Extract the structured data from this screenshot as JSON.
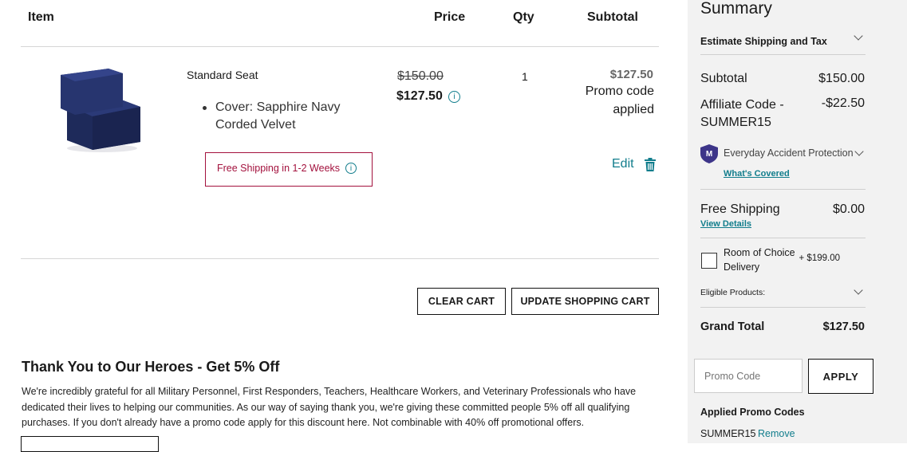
{
  "cart": {
    "headers": {
      "item": "Item",
      "price": "Price",
      "qty": "Qty",
      "subtotal": "Subtotal"
    },
    "item": {
      "name": "Standard Seat",
      "option": "Cover: Sapphire Navy Corded Velvet",
      "original_price": "$150.00",
      "price": "$127.50",
      "qty": "1",
      "subtotal": "$127.50",
      "promo_note": "Promo code applied",
      "shipping_note": "Free Shipping in 1-2 Weeks",
      "edit_label": "Edit"
    },
    "buttons": {
      "clear": "CLEAR CART",
      "update": "UPDATE SHOPPING CART"
    }
  },
  "heroes": {
    "title": "Thank You to Our Heroes - Get 5% Off",
    "body": "We're incredibly grateful for all Military Personnel, First Responders, Teachers, Healthcare Workers, and Veterinary Professionals who have dedicated their lives to helping our communities. As our way of saying thank you, we're giving these committed people 5% off all qualifying purchases. If you don't already have a promo code apply for this discount here. Not combinable with 40% off promotional offers."
  },
  "summary": {
    "title": "Summary",
    "estimate_label": "Estimate Shipping and Tax",
    "subtotal_label": "Subtotal",
    "subtotal_value": "$150.00",
    "affiliate_label": "Affiliate Code - SUMMER15",
    "affiliate_value": "-$22.50",
    "protection_label": "Everyday Accident Protection",
    "protection_link": "What's Covered",
    "shipping_label": "Free Shipping",
    "shipping_value": "$0.00",
    "shipping_link": "View Details",
    "delivery_label": "Room of Choice Delivery",
    "delivery_value": "+ $199.00",
    "eligible_label": "Eligible Products:",
    "grand_total_label": "Grand Total",
    "grand_total_value": "$127.50",
    "promo_placeholder": "Promo Code",
    "apply_label": "APPLY",
    "applied_label": "Applied Promo Codes",
    "applied_code": "SUMMER15",
    "remove_label": "Remove"
  },
  "colors": {
    "teal": "#117d8c",
    "shipping_red": "#a3113d",
    "panel_bg": "#f2f2f2"
  }
}
